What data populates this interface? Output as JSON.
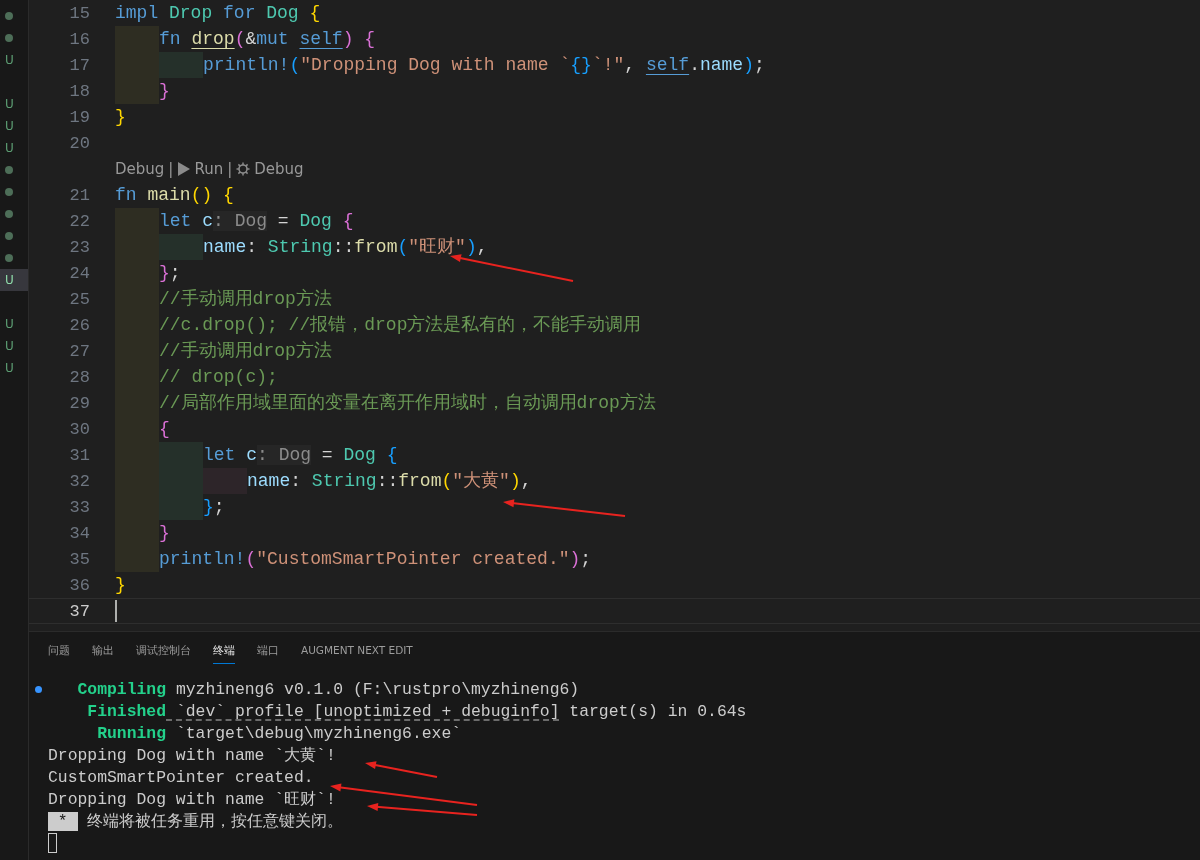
{
  "explorer_markers": [
    {
      "kind": "dot",
      "selected": false
    },
    {
      "kind": "dot",
      "selected": false
    },
    {
      "kind": "u",
      "text": "U",
      "selected": false
    },
    {
      "kind": "gap",
      "selected": false
    },
    {
      "kind": "u",
      "text": "U",
      "selected": false
    },
    {
      "kind": "u",
      "text": "U",
      "selected": false
    },
    {
      "kind": "u",
      "text": "U",
      "selected": false
    },
    {
      "kind": "dot",
      "selected": false
    },
    {
      "kind": "dot",
      "selected": false
    },
    {
      "kind": "dot",
      "selected": false
    },
    {
      "kind": "dot",
      "selected": false
    },
    {
      "kind": "dot",
      "selected": false
    },
    {
      "kind": "u",
      "text": "U",
      "selected": true
    },
    {
      "kind": "gap",
      "selected": false
    },
    {
      "kind": "u",
      "text": "U",
      "selected": false
    },
    {
      "kind": "u",
      "text": "U",
      "selected": false
    },
    {
      "kind": "u",
      "text": "U",
      "selected": false
    }
  ],
  "editor": {
    "rows": [
      {
        "kind": "code",
        "number": "15",
        "current": false,
        "tokens": [
          {
            "kind": "kw",
            "s": "impl "
          },
          {
            "kind": "type",
            "s": "Drop "
          },
          {
            "kind": "kw",
            "s": "for "
          },
          {
            "kind": "type",
            "s": "Dog "
          },
          {
            "kind": "gold",
            "s": "{"
          }
        ]
      },
      {
        "kind": "code",
        "number": "16",
        "current": false,
        "guides": [
          {
            "kind": "olive"
          }
        ],
        "tokens": [
          {
            "kind": "kw",
            "s": "fn "
          },
          {
            "kind": "fnu",
            "s": "drop"
          },
          {
            "kind": "pink",
            "s": "("
          },
          {
            "kind": "op",
            "s": "&"
          },
          {
            "kind": "kw",
            "s": "mut "
          },
          {
            "kind": "selfu",
            "s": "self"
          },
          {
            "kind": "pink",
            "s": ")"
          },
          {
            "kind": "pink",
            "s": " {"
          }
        ]
      },
      {
        "kind": "code",
        "number": "17",
        "current": false,
        "guides": [
          {
            "kind": "olive"
          },
          {
            "kind": "green"
          }
        ],
        "tokens": [
          {
            "kind": "macro",
            "s": "println!"
          },
          {
            "kind": "blue",
            "s": "("
          },
          {
            "kind": "str",
            "s": "\"Dropping Dog with name `"
          },
          {
            "kind": "blue",
            "s": "{}"
          },
          {
            "kind": "str",
            "s": "`!\""
          },
          {
            "kind": "op",
            "s": ", "
          },
          {
            "kind": "selfu",
            "s": "self"
          },
          {
            "kind": "op",
            "s": "."
          },
          {
            "kind": "var",
            "s": "name"
          },
          {
            "kind": "blue",
            "s": ")"
          },
          {
            "kind": "op",
            "s": ";"
          }
        ]
      },
      {
        "kind": "code",
        "number": "18",
        "current": false,
        "guides": [
          {
            "kind": "olive"
          }
        ],
        "tokens": [
          {
            "kind": "pink",
            "s": "}"
          }
        ]
      },
      {
        "kind": "code",
        "number": "19",
        "current": false,
        "tokens": [
          {
            "kind": "gold",
            "s": "}"
          }
        ]
      },
      {
        "kind": "code",
        "number": "20",
        "current": false
      },
      {
        "kind": "lens",
        "items": [
          {
            "kind": "text",
            "text": "Debug"
          },
          {
            "kind": "sep",
            "text": "|"
          },
          {
            "kind": "run",
            "text": "Run"
          },
          {
            "kind": "sep",
            "text": "|"
          },
          {
            "kind": "debug",
            "text": "Debug"
          }
        ]
      },
      {
        "kind": "code",
        "number": "21",
        "current": false,
        "tokens": [
          {
            "kind": "kw",
            "s": "fn "
          },
          {
            "kind": "fn",
            "s": "main"
          },
          {
            "kind": "gold",
            "s": "()"
          },
          {
            "kind": "gold",
            "s": " {"
          }
        ]
      },
      {
        "kind": "code",
        "number": "22",
        "current": false,
        "guides": [
          {
            "kind": "olive"
          }
        ],
        "tokens": [
          {
            "kind": "kw",
            "s": "let "
          },
          {
            "kind": "var",
            "s": "c"
          },
          {
            "kind": "hint",
            "s": ": Dog"
          },
          {
            "kind": "op",
            "s": " = "
          },
          {
            "kind": "type",
            "s": "Dog "
          },
          {
            "kind": "pink",
            "s": "{"
          }
        ]
      },
      {
        "kind": "code",
        "number": "23",
        "current": false,
        "guides": [
          {
            "kind": "olive"
          },
          {
            "kind": "green"
          }
        ],
        "tokens": [
          {
            "kind": "var",
            "s": "name"
          },
          {
            "kind": "op",
            "s": ": "
          },
          {
            "kind": "type",
            "s": "String"
          },
          {
            "kind": "op",
            "s": "::"
          },
          {
            "kind": "fn",
            "s": "from"
          },
          {
            "kind": "blue",
            "s": "("
          },
          {
            "kind": "str",
            "s": "\"旺财\""
          },
          {
            "kind": "blue",
            "s": ")"
          },
          {
            "kind": "op",
            "s": ","
          }
        ]
      },
      {
        "kind": "code",
        "number": "24",
        "current": false,
        "guides": [
          {
            "kind": "olive"
          }
        ],
        "tokens": [
          {
            "kind": "pink",
            "s": "}"
          },
          {
            "kind": "op",
            "s": ";"
          }
        ]
      },
      {
        "kind": "code",
        "number": "25",
        "current": false,
        "guides": [
          {
            "kind": "olive"
          }
        ],
        "tokens": [
          {
            "kind": "cmt",
            "s": "//手动调用drop方法"
          }
        ]
      },
      {
        "kind": "code",
        "number": "26",
        "current": false,
        "guides": [
          {
            "kind": "olive"
          }
        ],
        "tokens": [
          {
            "kind": "cmt",
            "s": "//c.drop(); //报错，drop方法是私有的，不能手动调用"
          }
        ]
      },
      {
        "kind": "code",
        "number": "27",
        "current": false,
        "guides": [
          {
            "kind": "olive"
          }
        ],
        "tokens": [
          {
            "kind": "cmt",
            "s": "//手动调用drop方法"
          }
        ]
      },
      {
        "kind": "code",
        "number": "28",
        "current": false,
        "guides": [
          {
            "kind": "olive"
          }
        ],
        "tokens": [
          {
            "kind": "cmt",
            "s": "// drop(c);"
          }
        ]
      },
      {
        "kind": "code",
        "number": "29",
        "current": false,
        "guides": [
          {
            "kind": "olive"
          }
        ],
        "tokens": [
          {
            "kind": "cmt",
            "s": "//局部作用域里面的变量在离开作用域时，自动调用drop方法"
          }
        ]
      },
      {
        "kind": "code",
        "number": "30",
        "current": false,
        "guides": [
          {
            "kind": "olive"
          }
        ],
        "tokens": [
          {
            "kind": "pink",
            "s": "{"
          }
        ]
      },
      {
        "kind": "code",
        "number": "31",
        "current": false,
        "guides": [
          {
            "kind": "olive"
          },
          {
            "kind": "green"
          }
        ],
        "tokens": [
          {
            "kind": "kw",
            "s": "let "
          },
          {
            "kind": "var",
            "s": "c"
          },
          {
            "kind": "hint",
            "s": ": Dog"
          },
          {
            "kind": "op",
            "s": " = "
          },
          {
            "kind": "type",
            "s": "Dog "
          },
          {
            "kind": "blue",
            "s": "{"
          }
        ]
      },
      {
        "kind": "code",
        "number": "32",
        "current": false,
        "guides": [
          {
            "kind": "olive"
          },
          {
            "kind": "green"
          },
          {
            "kind": "plum"
          }
        ],
        "tokens": [
          {
            "kind": "var",
            "s": "name"
          },
          {
            "kind": "op",
            "s": ": "
          },
          {
            "kind": "type",
            "s": "String"
          },
          {
            "kind": "op",
            "s": "::"
          },
          {
            "kind": "fn",
            "s": "from"
          },
          {
            "kind": "gold",
            "s": "("
          },
          {
            "kind": "str",
            "s": "\"大黄\""
          },
          {
            "kind": "gold",
            "s": ")"
          },
          {
            "kind": "op",
            "s": ","
          }
        ]
      },
      {
        "kind": "code",
        "number": "33",
        "current": false,
        "guides": [
          {
            "kind": "olive"
          },
          {
            "kind": "green"
          }
        ],
        "tokens": [
          {
            "kind": "blue",
            "s": "}"
          },
          {
            "kind": "op",
            "s": ";"
          }
        ]
      },
      {
        "kind": "code",
        "number": "34",
        "current": false,
        "guides": [
          {
            "kind": "olive"
          }
        ],
        "tokens": [
          {
            "kind": "pink",
            "s": "}"
          }
        ]
      },
      {
        "kind": "code",
        "number": "35",
        "current": false,
        "guides": [
          {
            "kind": "olive"
          }
        ],
        "tokens": [
          {
            "kind": "macro",
            "s": "println!"
          },
          {
            "kind": "pink",
            "s": "("
          },
          {
            "kind": "str",
            "s": "\"CustomSmartPointer created.\""
          },
          {
            "kind": "pink",
            "s": ")"
          },
          {
            "kind": "op",
            "s": ";"
          }
        ]
      },
      {
        "kind": "code",
        "number": "36",
        "current": false,
        "tokens": [
          {
            "kind": "gold",
            "s": "}"
          }
        ]
      },
      {
        "kind": "code",
        "number": "37",
        "current": true
      }
    ]
  },
  "panel": {
    "tabs": [
      {
        "label": "问题",
        "selected": false
      },
      {
        "label": "输出",
        "selected": false
      },
      {
        "label": "调试控制台",
        "selected": false
      },
      {
        "label": "终端",
        "selected": true
      },
      {
        "label": "端口",
        "selected": false
      },
      {
        "label": "AUGMENT NEXT EDIT",
        "selected": false
      }
    ],
    "terminal": {
      "cursor": true,
      "lines": [
        {
          "dot": true,
          "segments": [
            {
              "kind": "status",
              "s": "   Compiling"
            },
            {
              "kind": "plain",
              "s": " myzhineng6 v0.1.0 (F:\\rustpro\\myzhineng6)"
            }
          ]
        },
        {
          "dot": false,
          "segments": [
            {
              "kind": "status",
              "s": "    Finished"
            },
            {
              "kind": "link",
              "s": " `dev` profile [unoptimized + debuginfo]"
            },
            {
              "kind": "plain",
              "s": " target(s) in 0.64s"
            }
          ]
        },
        {
          "dot": false,
          "segments": [
            {
              "kind": "status",
              "s": "     Running"
            },
            {
              "kind": "plain",
              "s": " `target\\debug\\myzhineng6.exe`"
            }
          ]
        },
        {
          "dot": false,
          "segments": [
            {
              "kind": "plain",
              "s": "Dropping Dog with name `大黄`!"
            }
          ]
        },
        {
          "dot": false,
          "segments": [
            {
              "kind": "plain",
              "s": "CustomSmartPointer created."
            }
          ]
        },
        {
          "dot": false,
          "segments": [
            {
              "kind": "plain",
              "s": "Dropping Dog with name `旺财`!"
            }
          ]
        },
        {
          "dot": false,
          "segments": [
            {
              "kind": "badge",
              "s": " * "
            },
            {
              "kind": "plain",
              "s": " 终端将被任务重用，按任意键关闭。"
            }
          ]
        }
      ]
    }
  }
}
